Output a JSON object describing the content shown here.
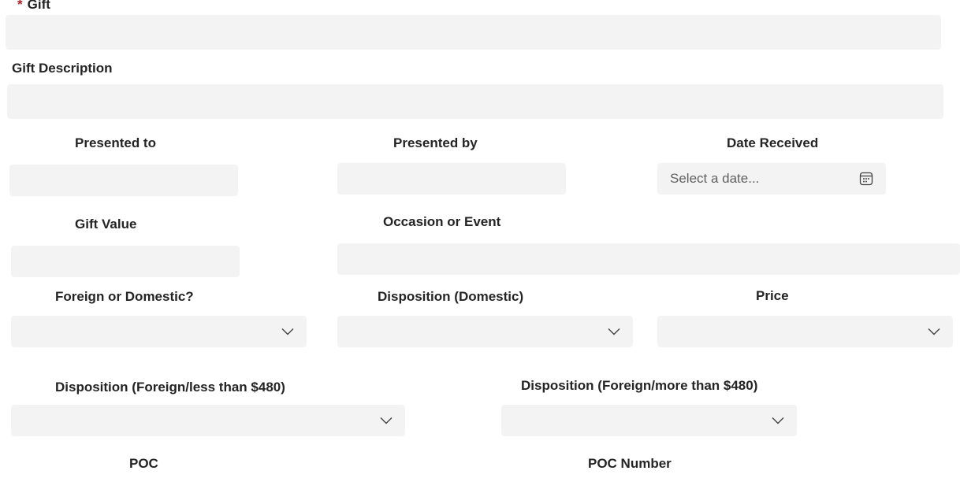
{
  "form": {
    "gift": {
      "label": "Gift",
      "required_mark": "*",
      "value": ""
    },
    "gift_description": {
      "label": "Gift Description",
      "value": ""
    },
    "presented_to": {
      "label": "Presented to",
      "value": ""
    },
    "presented_by": {
      "label": "Presented by",
      "value": ""
    },
    "date_received": {
      "label": "Date Received",
      "placeholder": "Select a date...",
      "icon": "calendar-icon"
    },
    "gift_value": {
      "label": "Gift Value",
      "value": ""
    },
    "occasion": {
      "label": "Occasion or Event",
      "value": ""
    },
    "foreign_or_domestic": {
      "label": "Foreign or Domestic?",
      "selected": "",
      "icon": "chevron-down-icon"
    },
    "disposition_domestic": {
      "label": "Disposition (Domestic)",
      "selected": "",
      "icon": "chevron-down-icon"
    },
    "price": {
      "label": "Price",
      "selected": "",
      "icon": "chevron-down-icon"
    },
    "disposition_foreign_less": {
      "label": "Disposition (Foreign/less than $480)",
      "selected": "",
      "icon": "chevron-down-icon"
    },
    "disposition_foreign_more": {
      "label": "Disposition (Foreign/more than $480)",
      "selected": "",
      "icon": "chevron-down-icon"
    },
    "poc": {
      "label": "POC"
    },
    "poc_number": {
      "label": "POC Number"
    }
  },
  "colors": {
    "field_bg": "#f3f3f3",
    "required": "#a4262c",
    "text": "#242424",
    "placeholder": "#616161"
  }
}
